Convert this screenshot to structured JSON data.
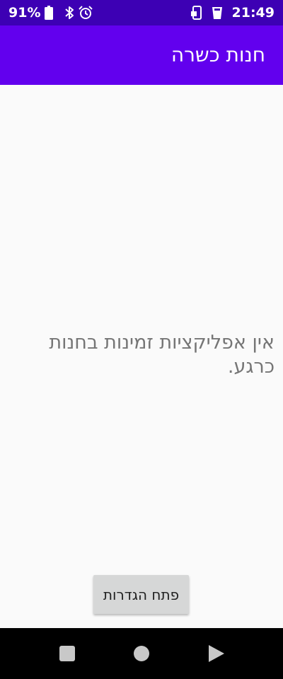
{
  "status_bar": {
    "battery_percent": "91%",
    "time": "21:49",
    "icons": [
      "battery-icon",
      "bluetooth-icon",
      "alarm-icon",
      "phone-sync-icon",
      "notification-icon"
    ]
  },
  "app_bar": {
    "title": "חנות כשרה",
    "color": "#6200ee",
    "status_color": "#3d00b4"
  },
  "main": {
    "empty_message": "אין אפליקציות זמינות בחנות כרגע.",
    "settings_button_label": "פתח הגדרות"
  },
  "nav_bar": {
    "buttons": [
      "recents-button",
      "home-button",
      "back-button"
    ]
  }
}
